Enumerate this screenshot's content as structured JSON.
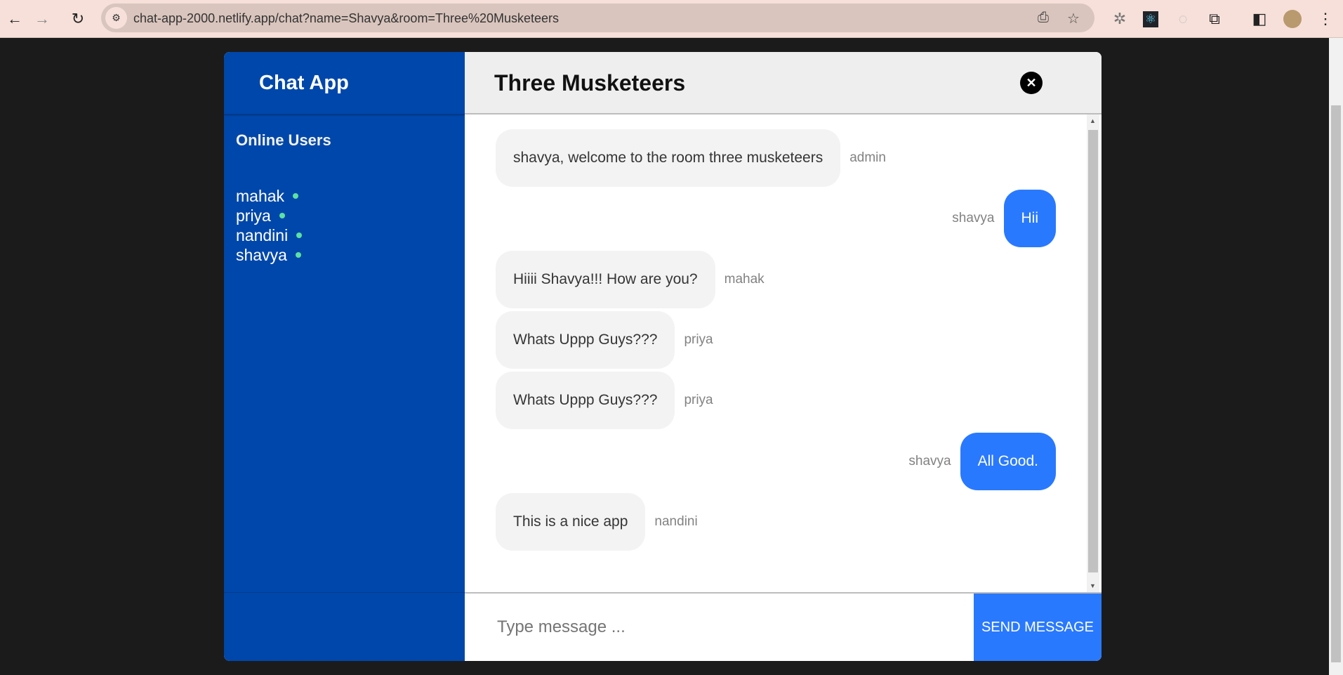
{
  "browser": {
    "url": "chat-app-2000.netlify.app/chat?name=Shavya&room=Three%20Musketeers"
  },
  "sidebar": {
    "app_title": "Chat App",
    "online_title": "Online Users",
    "users": [
      "mahak",
      "priya",
      "nandini",
      "shavya"
    ],
    "online_color": "#5ce1a0"
  },
  "header": {
    "room_name": "Three Musketeers"
  },
  "messages": [
    {
      "text": "shavya, welcome to the room three musketeers",
      "sender": "admin",
      "side": "left"
    },
    {
      "text": "Hii",
      "sender": "shavya",
      "side": "right"
    },
    {
      "text": "Hiiii Shavya!!! How are you?",
      "sender": "mahak",
      "side": "left"
    },
    {
      "text": "Whats Uppp Guys???",
      "sender": "priya",
      "side": "left"
    },
    {
      "text": "Whats Uppp Guys???",
      "sender": "priya",
      "side": "left"
    },
    {
      "text": "All Good.",
      "sender": "shavya",
      "side": "right"
    },
    {
      "text": "This is a nice app",
      "sender": "nandini",
      "side": "left"
    }
  ],
  "composer": {
    "placeholder": "Type message ...",
    "value": "",
    "send_label": "SEND MESSAGE"
  },
  "colors": {
    "sidebar": "#0047ab",
    "accent": "#2979ff"
  }
}
